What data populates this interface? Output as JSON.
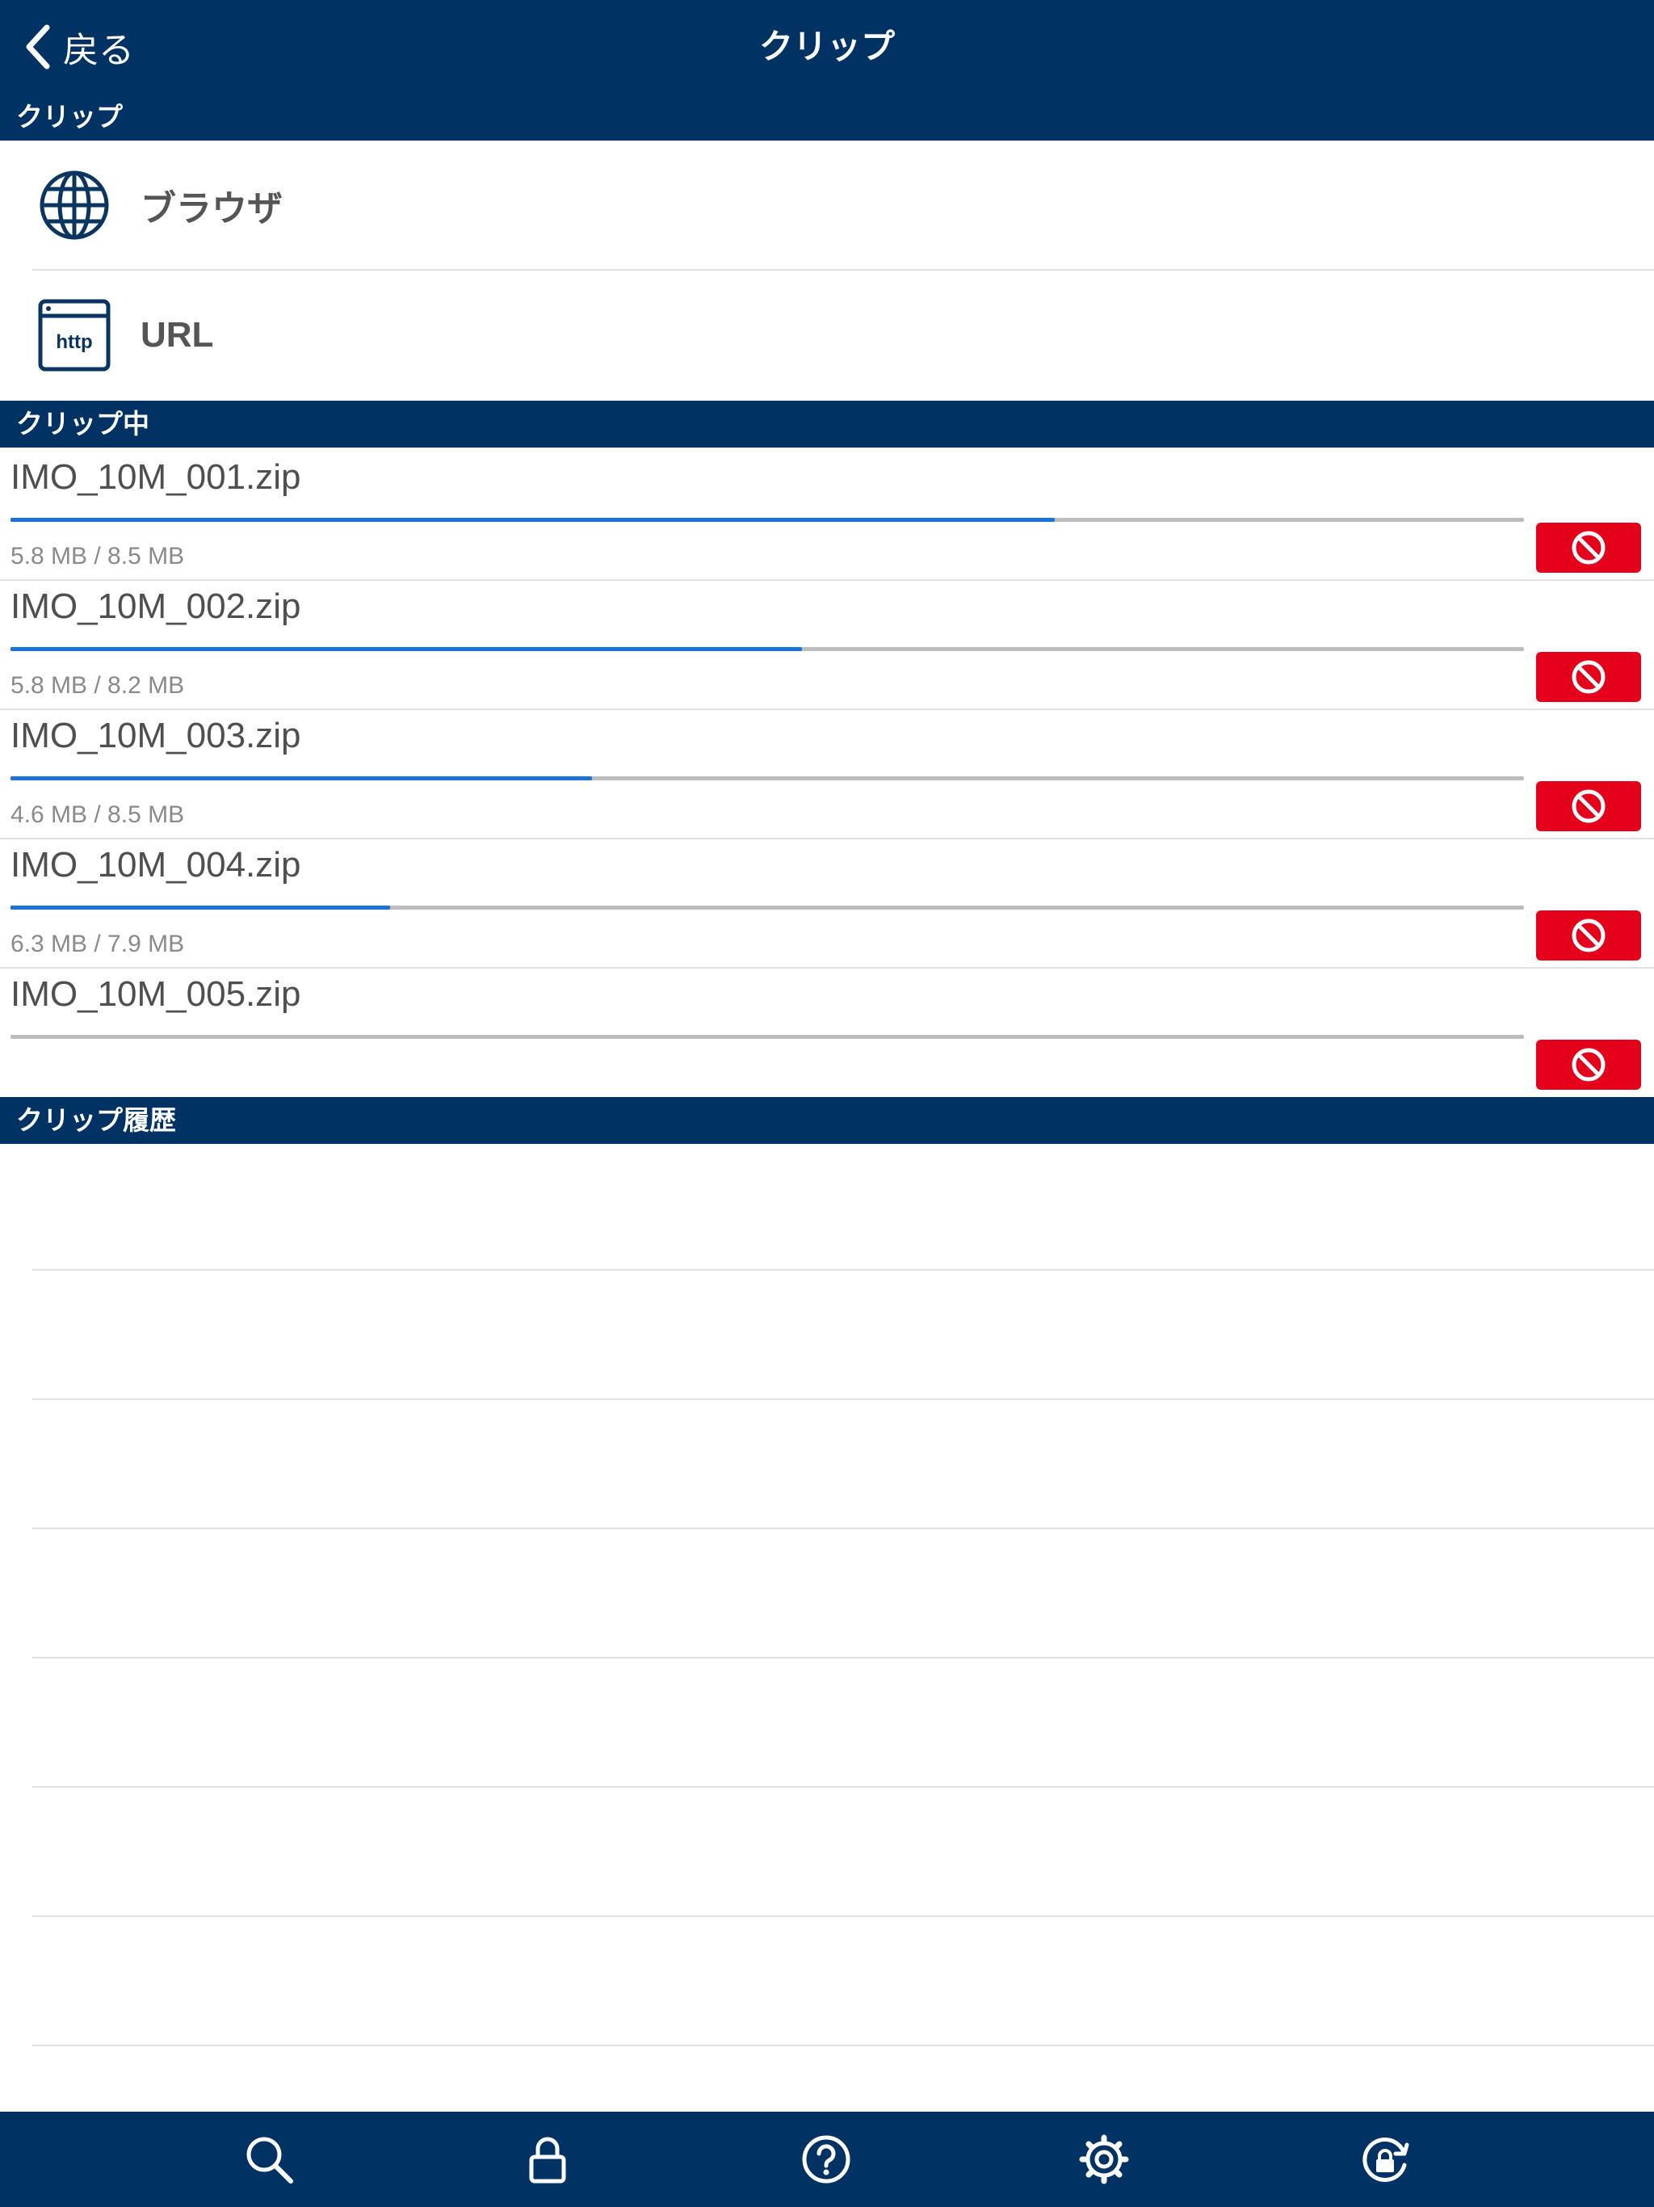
{
  "nav": {
    "back_label": "戻る",
    "title": "クリップ"
  },
  "sections": {
    "clip": "クリップ",
    "clipping": "クリップ中",
    "history": "クリップ履歴"
  },
  "clip_menu": [
    {
      "label": "ブラウザ",
      "icon": "globe-icon"
    },
    {
      "label": "URL",
      "icon": "http-icon"
    }
  ],
  "downloads": [
    {
      "name": "IMO_10M_001.zip",
      "size": "5.8 MB / 8.5 MB",
      "progress": 0.69
    },
    {
      "name": "IMO_10M_002.zip",
      "size": "5.8 MB / 8.2 MB",
      "progress": 0.523
    },
    {
      "name": "IMO_10M_003.zip",
      "size": "4.6 MB / 8.5 MB",
      "progress": 0.384
    },
    {
      "name": "IMO_10M_004.zip",
      "size": "6.3 MB / 7.9 MB",
      "progress": 0.251
    },
    {
      "name": "IMO_10M_005.zip",
      "size": "",
      "progress": 0
    }
  ],
  "tabbar": [
    "search-icon",
    "lock-icon",
    "help-icon",
    "settings-icon",
    "lock-rotation-icon"
  ],
  "colors": {
    "primary": "#003263",
    "progress": "#1a73d6",
    "cancel": "#e4001b"
  }
}
